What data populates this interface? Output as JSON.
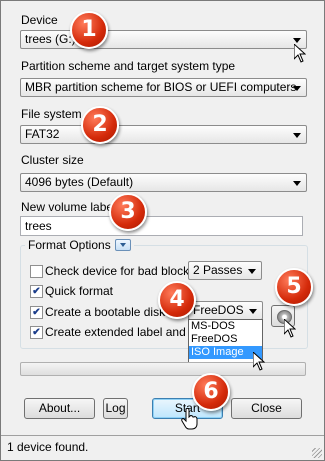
{
  "device": {
    "label": "Device",
    "value": "trees (G:)"
  },
  "partition": {
    "label": "Partition scheme and target system type",
    "value": "MBR partition scheme for BIOS or UEFI computers"
  },
  "filesystem": {
    "label": "File system",
    "value": "FAT32"
  },
  "cluster": {
    "label": "Cluster size",
    "value": "4096 bytes (Default)"
  },
  "volume": {
    "label": "New volume label",
    "value": "trees"
  },
  "format_options": {
    "title": "Format Options",
    "bad_blocks": {
      "label": "Check device for bad blocks:",
      "checked": false,
      "passes": "2 Passes"
    },
    "quick_format": {
      "label": "Quick format",
      "checked": true
    },
    "bootable": {
      "label": "Create a bootable disk us",
      "checked": true,
      "value": "FreeDOS"
    },
    "extended_label": {
      "label": "Create extended label and ico",
      "checked": true
    },
    "dropdown_options": [
      "MS-DOS",
      "FreeDOS",
      "ISO Image"
    ],
    "dropdown_selected": "ISO Image"
  },
  "buttons": {
    "about": "About...",
    "log": "Log",
    "start": "Start",
    "close": "Close"
  },
  "status": "1 device found.",
  "badges": [
    "1",
    "2",
    "3",
    "4",
    "5",
    "6"
  ],
  "icons": {
    "disk_icon": "drive-icon",
    "badge_color": "#d42a0a"
  }
}
